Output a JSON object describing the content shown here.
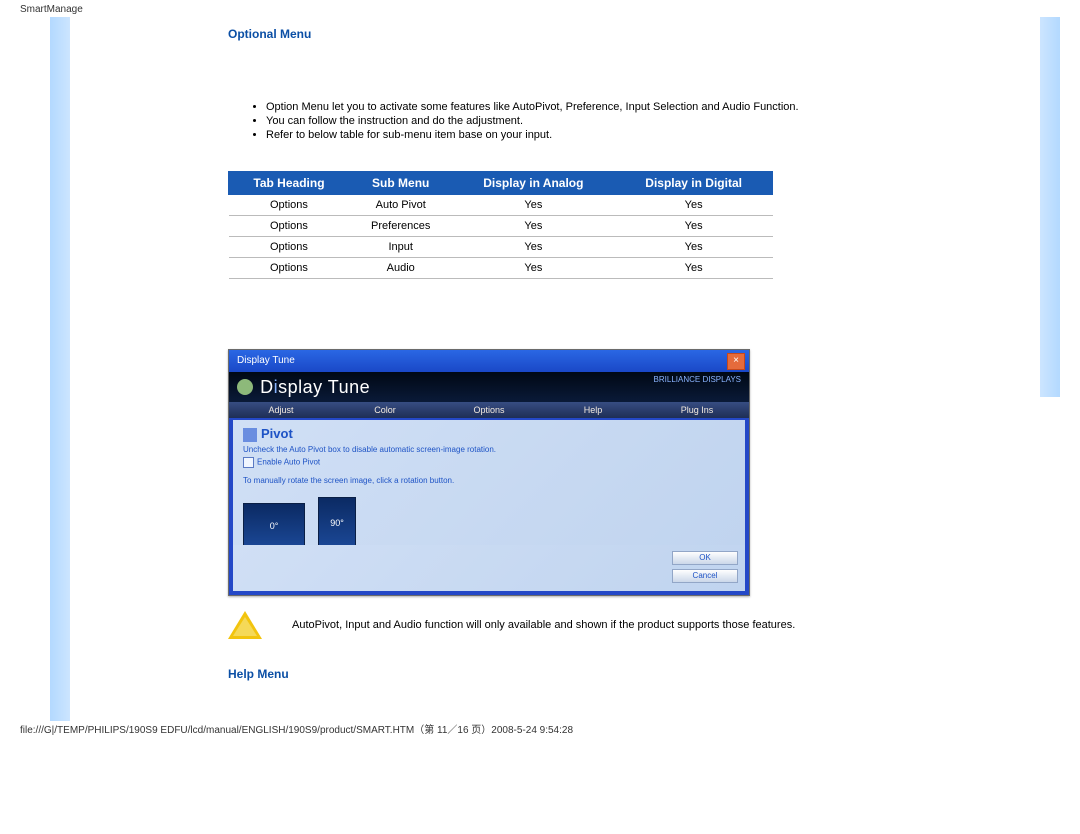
{
  "top_label": "SmartManage",
  "section1_title": "Optional Menu",
  "bullets": [
    "Option Menu let you to activate some features like AutoPivot, Preference, Input Selection and Audio Function.",
    "You can follow the instruction and do the adjustment.",
    "Refer to below table for sub-menu item base on your input."
  ],
  "table_headers": [
    "Tab Heading",
    "Sub Menu",
    "Display in Analog",
    "Display in Digital"
  ],
  "table_rows": [
    [
      "Options",
      "Auto Pivot",
      "Yes",
      "Yes"
    ],
    [
      "Options",
      "Preferences",
      "Yes",
      "Yes"
    ],
    [
      "Options",
      "Input",
      "Yes",
      "Yes"
    ],
    [
      "Options",
      "Audio",
      "Yes",
      "Yes"
    ]
  ],
  "app": {
    "window_title": "Display Tune",
    "brand": "Display Tune",
    "brand_right": "BRILLIANCE\nDISPLAYS",
    "tabs": [
      "Adjust",
      "Color",
      "Options",
      "Help",
      "Plug Ins"
    ],
    "panel_title": "Pivot",
    "hint": "Uncheck the Auto Pivot box to disable automatic screen-image rotation.",
    "checkbox_label": "Enable Auto Pivot",
    "manual_hint": "To manually rotate the screen image, click a rotation button.",
    "mon0": "0°",
    "mon90": "90°",
    "ok": "OK",
    "cancel": "Cancel"
  },
  "note": "AutoPivot, Input and Audio function will only available and shown if the product supports those features.",
  "section2_title": "Help Menu",
  "footer": "file:///G|/TEMP/PHILIPS/190S9 EDFU/lcd/manual/ENGLISH/190S9/product/SMART.HTM（第 11／16 页）2008-5-24 9:54:28"
}
